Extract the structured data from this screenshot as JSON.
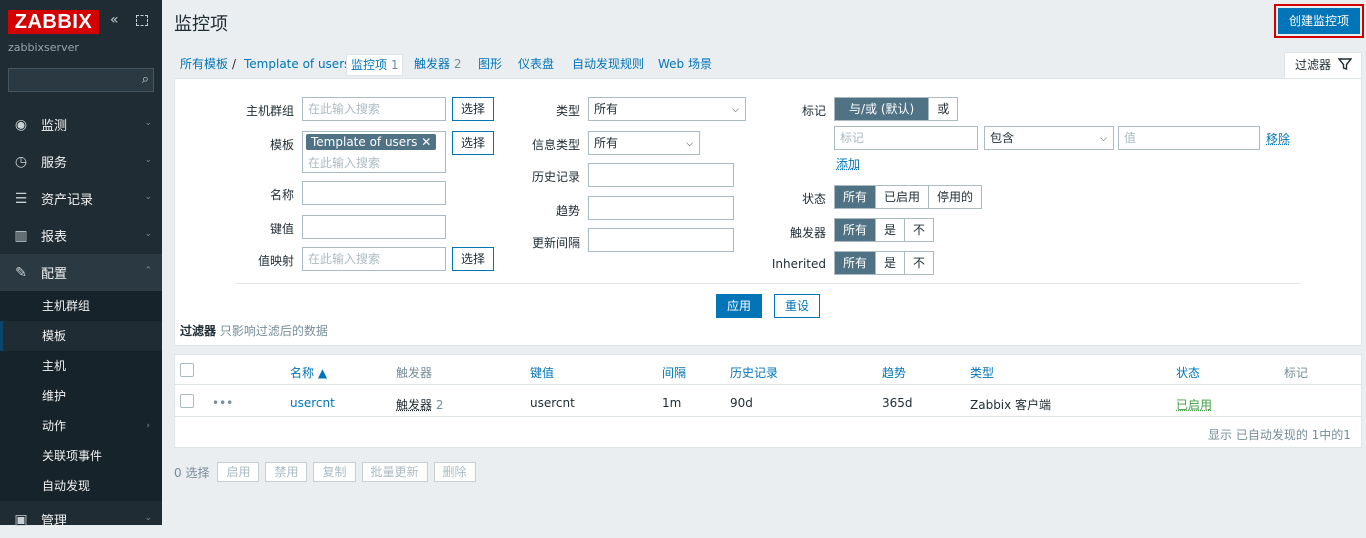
{
  "sidebar": {
    "logo": "ZABBIX",
    "collapse_icon": "double-chevron-left",
    "server": "zabbixserver",
    "menu": [
      {
        "label": "监测",
        "icon": "eye-icon"
      },
      {
        "label": "服务",
        "icon": "clock-icon"
      },
      {
        "label": "资产记录",
        "icon": "list-icon"
      },
      {
        "label": "报表",
        "icon": "chart-icon"
      },
      {
        "label": "配置",
        "icon": "wrench-icon"
      }
    ],
    "submenu": [
      "主机群组",
      "模板",
      "主机",
      "维护",
      "动作",
      "关联项事件",
      "自动发现"
    ],
    "admin": "管理"
  },
  "header": {
    "title": "监控项",
    "create_button": "创建监控项"
  },
  "nav": {
    "all_templates": "所有模板",
    "separator": "/",
    "template": "Template of users",
    "items": "监控项",
    "items_count": "1",
    "triggers": "触发器",
    "triggers_count": "2",
    "graphs": "图形",
    "dashboards": "仪表盘",
    "discovery": "自动发现规则",
    "web": "Web 场景"
  },
  "filter_tab": "过滤器",
  "filter": {
    "host_group_label": "主机群组",
    "search_placeholder": "在此输入搜索",
    "select_button": "选择",
    "template_label": "模板",
    "template_chip": "Template of users",
    "chip_remove": "✕",
    "name_label": "名称",
    "key_label": "键值",
    "valuemap_label": "值映射",
    "type_label": "类型",
    "type_value": "所有",
    "info_type_label": "信息类型",
    "info_type_value": "所有",
    "history_label": "历史记录",
    "trends_label": "趋势",
    "interval_label": "更新间隔",
    "tags_label": "标记",
    "tags_and_or": "与/或 (默认)",
    "tags_or": "或",
    "tag_placeholder": "标记",
    "tag_op": "包含",
    "value_placeholder": "值",
    "remove_link": "移除",
    "add_link": "添加",
    "state_label": "状态",
    "state_all": "所有",
    "state_enabled": "已启用",
    "state_disabled": "停用的",
    "triggers_label": "触发器",
    "inherited_label": "Inherited",
    "opt_all": "所有",
    "opt_yes": "是",
    "opt_no": "不",
    "apply": "应用",
    "reset": "重设",
    "note_title": "过滤器",
    "note_text": "只影响过滤后的数据"
  },
  "table": {
    "headers": [
      "名称 ▲",
      "触发器",
      "键值",
      "间隔",
      "历史记录",
      "趋势",
      "类型",
      "状态",
      "标记"
    ],
    "row": {
      "dots": "•••",
      "name": "usercnt",
      "triggers": "触发器",
      "triggers_count": "2",
      "key": "usercnt",
      "interval": "1m",
      "history": "90d",
      "trends": "365d",
      "type": "Zabbix 客户端",
      "status": "已启用"
    },
    "footer": "显示 已自动发现的 1中的1"
  },
  "bottom": {
    "selected": "0 选择",
    "buttons": [
      "启用",
      "禁用",
      "复制",
      "批量更新",
      "删除"
    ]
  },
  "colors": {
    "accent": "#0275b8",
    "brand": "#d40000",
    "enabled": "#429e47",
    "sidebar": "#1f2c33"
  }
}
